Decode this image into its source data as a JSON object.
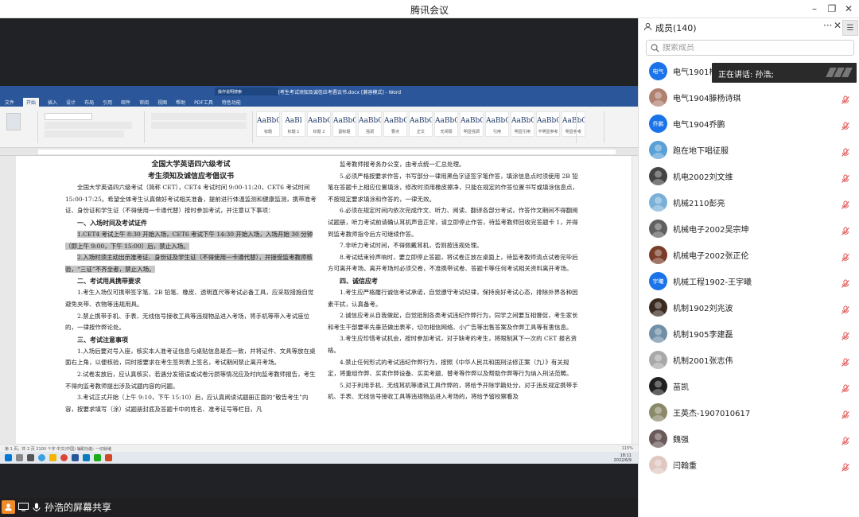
{
  "window": {
    "title": "腾讯会议"
  },
  "share": {
    "sharer_label": "孙浩的屏幕共享"
  },
  "word": {
    "doc_title": "全国大学英语四六级考生考试须知及诚信应考倡议书.docx [兼容模式] - Word",
    "search_hint": "操作说明搜索",
    "tabs": [
      "文件",
      "开始",
      "插入",
      "设计",
      "布局",
      "引用",
      "邮件",
      "审阅",
      "视图",
      "帮助",
      "PDF工具",
      "特色功能"
    ],
    "styles": [
      {
        "sample": "AaBbC",
        "label": "标题"
      },
      {
        "sample": "AaBl",
        "label": "标题 1"
      },
      {
        "sample": "AaBbC",
        "label": "标题 2"
      },
      {
        "sample": "AaBbC",
        "label": "副标题"
      },
      {
        "sample": "AaBbC",
        "label": "强调"
      },
      {
        "sample": "AaBbC",
        "label": "要点"
      },
      {
        "sample": "AaBbC",
        "label": "正文"
      },
      {
        "sample": "AaBbC",
        "label": "无间隔"
      },
      {
        "sample": "AaBbC",
        "label": "明显强调"
      },
      {
        "sample": "AaBbC",
        "label": "引用"
      },
      {
        "sample": "AaBbC",
        "label": "明显引用"
      },
      {
        "sample": "AaBbC",
        "label": "不明显参考"
      },
      {
        "sample": "AaBbC",
        "label": "明显参考"
      }
    ],
    "left_column": [
      {
        "kind": "center",
        "text": "全国大学英语四六级考试"
      },
      {
        "kind": "center",
        "text": "考生须知及诚信应考倡议书"
      },
      {
        "kind": "p",
        "text": "全国大学英语四六级考试（简称 CET），CET4 考试时间 9:00-11:20，CET6 考试时间 15:00-17:25。希望全体考生认真做好考试相关准备，提前进行体温监测和健康监测，携带准考证、身份证和学生证（不得使用一卡通代替）按时参加考试，并注意以下事项："
      },
      {
        "kind": "h",
        "text": "一、入场时间及考试证件"
      },
      {
        "kind": "hl",
        "text": "1.CET4 考试上午 8:30 开始入场，CET6 考试下午 14:30 开始入场，入场开始 30 分钟（即上午 9:00，下午 15:00）后，禁止入场。"
      },
      {
        "kind": "hl",
        "text": "2.入场时须主动出示准考证、身份证及学生证（不得使用一卡通代替），并接受监考教师核验，“三证”不齐全者，禁止入场。"
      },
      {
        "kind": "h",
        "text": "二、考试用具携带要求"
      },
      {
        "kind": "p",
        "text": "1.考生入场仅可携带签字笔、2B 铅笔、橡皮、透明直尺等考试必备工具，应采取措施自觉避免夹带、衣物等违规用具。"
      },
      {
        "kind": "p",
        "text": "2.禁止携带手机、手表、无线信号接收工具等违规物品进入考场，将手机等带入考试座位的，一律按作弊论处。"
      },
      {
        "kind": "h",
        "text": "三、考试注意事项"
      },
      {
        "kind": "p",
        "text": "1.入场后要对号入座，核实本人准考证信息与桌贴信息是否一致，并将证件、文具等放在桌面右上角，以便核验，同时按要求在考生签到表上签名，考试期间禁止离开考场。"
      },
      {
        "kind": "p",
        "text": "2.试卷发放后，应认真核实，若遇分发错误或试卷污损等情况应及时向监考教师报告，考生不得向监考教师提出涉及试题内容的问题。"
      },
      {
        "kind": "p",
        "text": "3.考试正式开始（上午 9:10，下午 15:10）后，应认真阅读试题册正面的“敬告考生”内容，按要求填写（涂）试题册封底及答题卡中的姓名、准考证号等栏目，凡"
      }
    ],
    "right_column": [
      {
        "kind": "p",
        "text": "监考教师报考务办公室，由考点统一汇总处理。"
      },
      {
        "kind": "p",
        "text": "5.必须严格按要求作答，书写部分一律用黑色字迹签字笔作答，填涂信息点时须使用 2B 铅笔在答题卡上相应位置填涂，修改时须用橡皮擦净，只能在规定的作答位置书写或填涂信息点，不按规定要求填涂和作答的，一律无效。"
      },
      {
        "kind": "p",
        "text": "6.必须在规定时间内依次完成作文、听力、阅读、翻译各部分考试，作答作文期间不得翻阅试题册，听力考试前请确认耳机声音正常，请立即停止作答，待监考教师回收完答题卡 1，并得到监考教师指令后方可继续作答。"
      },
      {
        "kind": "p",
        "text": "7.非听力考试时间，不得佩戴耳机，否则按违规处理。"
      },
      {
        "kind": "p",
        "text": "8.考试结束铃声响时，要立即停止答题，将试卷正放在桌面上，待监考教师清点试卷完毕后方可离开考场。离开考场时必须交卷，不准携带试卷、答题卡等任何考试相关资料离开考场。"
      },
      {
        "kind": "h",
        "text": "四、诚信应考"
      },
      {
        "kind": "p",
        "text": "1.考生应严格履行诚信考试承诺，自觉遵守考试纪律，保持良好考试心态，排除外界各种因素干扰，认真备考。"
      },
      {
        "kind": "p",
        "text": "2.诚信应考从自我做起，自觉抵制各类考试违纪作弊行为，同学之间要互相督促，考生家长和考生干部要率先垂范做出表率，切勿相信网络、小广告等出售答案及作弊工具等有害信息。"
      },
      {
        "kind": "p",
        "text": "3.考生应珍惜考试机会，按时参加考试，对于缺考的考生，将限制其下一次的 CET 报名资格。"
      },
      {
        "kind": "p",
        "text": "4.禁止任何形式的考试违纪作弊行为，按照《中华人民共和国刑法修正案（九）》有关规定，将重组作弊、买卖作弊设备、买卖考题、替考等作弊以及帮助作弊等行为纳入刑法范畴。"
      },
      {
        "kind": "p",
        "text": "5.对于利用手机、无线耳机等通讯工具作弊的，将给予开除学籍处分，对于违反规定携带手机、手表、无线信号接收工具等违规物品进入考场的，将给予留校察看及"
      }
    ],
    "status_text": "第 1 页，共 2 页    2100 个字    中文(中国)    辅助功能: 一切就绪",
    "zoom": "115%",
    "clock_time": "18:11",
    "clock_date": "2022/6/9"
  },
  "panel": {
    "title": "成员(140)",
    "search_placeholder": "搜索成员",
    "speaking_label": "正在讲话: 孙浩;",
    "members": [
      {
        "name": "电气1901杨",
        "avatar_text": "电气",
        "color": "#1a73e8"
      },
      {
        "name": "电气1904滕杨诗琪",
        "avatar_text": "",
        "color": "#b08070"
      },
      {
        "name": "电气1904乔鹏",
        "avatar_text": "乔鹏",
        "color": "#1a73e8"
      },
      {
        "name": "跑在地下唱征服",
        "avatar_text": "",
        "color": "#5aa0d6"
      },
      {
        "name": "机电2002刘文维",
        "avatar_text": "",
        "color": "#444444"
      },
      {
        "name": "机械2110彭亮",
        "avatar_text": "",
        "color": "#7ab0d8"
      },
      {
        "name": "机械电子2002吴宗坤",
        "avatar_text": "",
        "color": "#606060"
      },
      {
        "name": "机械电子2002张正伦",
        "avatar_text": "",
        "color": "#7a3d2a"
      },
      {
        "name": "机械工程1902-王宇曦",
        "avatar_text": "宇曦",
        "color": "#1a73e8"
      },
      {
        "name": "机制1902刘兆波",
        "avatar_text": "",
        "color": "#3a2a20"
      },
      {
        "name": "机制1905李建磊",
        "avatar_text": "",
        "color": "#7090a8"
      },
      {
        "name": "机制2001张志伟",
        "avatar_text": "",
        "color": "#a8a8a8"
      },
      {
        "name": "苗凯",
        "avatar_text": "",
        "color": "#202020"
      },
      {
        "name": "王英杰-1907010617",
        "avatar_text": "",
        "color": "#8a8a6a"
      },
      {
        "name": "魏强",
        "avatar_text": "",
        "color": "#6a5a5a"
      },
      {
        "name": "闫翰重",
        "avatar_text": "",
        "color": "#e0c8c0"
      }
    ]
  }
}
